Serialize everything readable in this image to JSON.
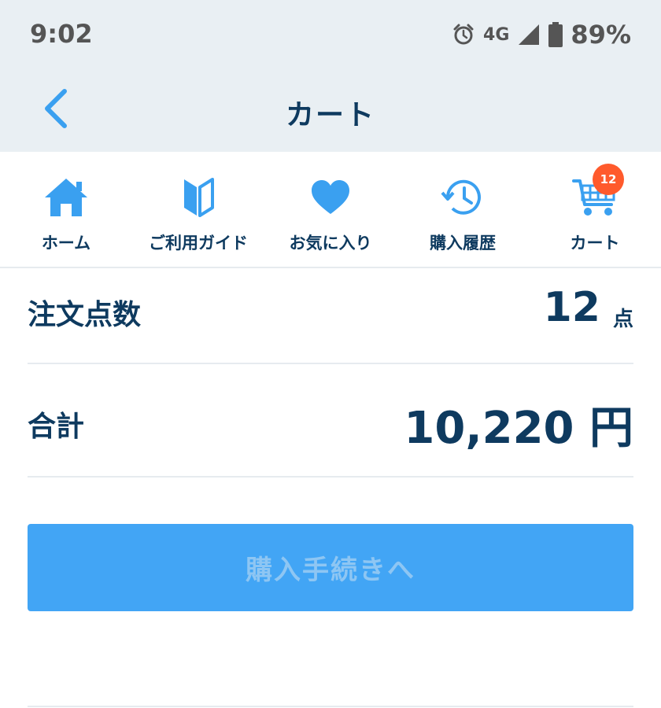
{
  "status_bar": {
    "time": "9:02",
    "network": "4G",
    "battery": "89%",
    "icons": [
      "alarm-icon",
      "signal-icon",
      "battery-icon"
    ]
  },
  "app_bar": {
    "title": "カート",
    "back_icon": "chevron-left-icon"
  },
  "nav": {
    "items": [
      {
        "label": "ホーム",
        "icon": "home-icon"
      },
      {
        "label": "ご利用ガイド",
        "icon": "beginner-mark-icon"
      },
      {
        "label": "お気に入り",
        "icon": "heart-icon"
      },
      {
        "label": "購入履歴",
        "icon": "history-icon"
      },
      {
        "label": "カート",
        "icon": "cart-icon"
      }
    ],
    "cart_badge": "12"
  },
  "summary": {
    "count_label": "注文点数",
    "count_value": "12",
    "count_unit": "点",
    "total_label": "合計",
    "total_value": "10,220 円"
  },
  "checkout": {
    "label": "購入手続きへ"
  },
  "colors": {
    "accent": "#42a5f5",
    "icon_blue": "#3aa0f0",
    "text_navy": "#0e3a5f",
    "badge": "#ff5a2c",
    "header_bg": "#e9eff3"
  }
}
